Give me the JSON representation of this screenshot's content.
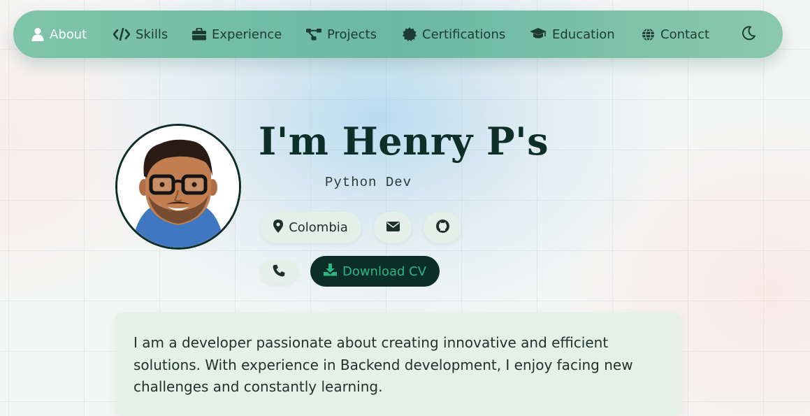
{
  "nav": {
    "items": [
      {
        "label": "About",
        "icon": "user-icon",
        "active": true
      },
      {
        "label": "Skills",
        "icon": "code-icon"
      },
      {
        "label": "Experience",
        "icon": "briefcase-icon"
      },
      {
        "label": "Projects",
        "icon": "project-diagram-icon"
      },
      {
        "label": "Certifications",
        "icon": "certificate-icon"
      },
      {
        "label": "Education",
        "icon": "graduation-cap-icon"
      },
      {
        "label": "Contact",
        "icon": "globe-icon"
      }
    ],
    "theme_toggle_icon": "moon-icon"
  },
  "hero": {
    "title": "I'm Henry P's",
    "subtitle": "Python Dev",
    "location": "Colombia",
    "location_icon": "map-pin-icon",
    "email_icon": "envelope-icon",
    "github_icon": "github-icon",
    "phone_icon": "phone-icon",
    "download_label": "Download CV",
    "download_icon": "download-icon"
  },
  "about": {
    "text": "I am a developer passionate about creating innovative and efficient solutions. With experience in Backend development, I enjoy facing new challenges and constantly learning."
  },
  "colors": {
    "accent": "#2fb484",
    "dark": "#0b2e27",
    "nav_bg": "#7fc4aa"
  }
}
